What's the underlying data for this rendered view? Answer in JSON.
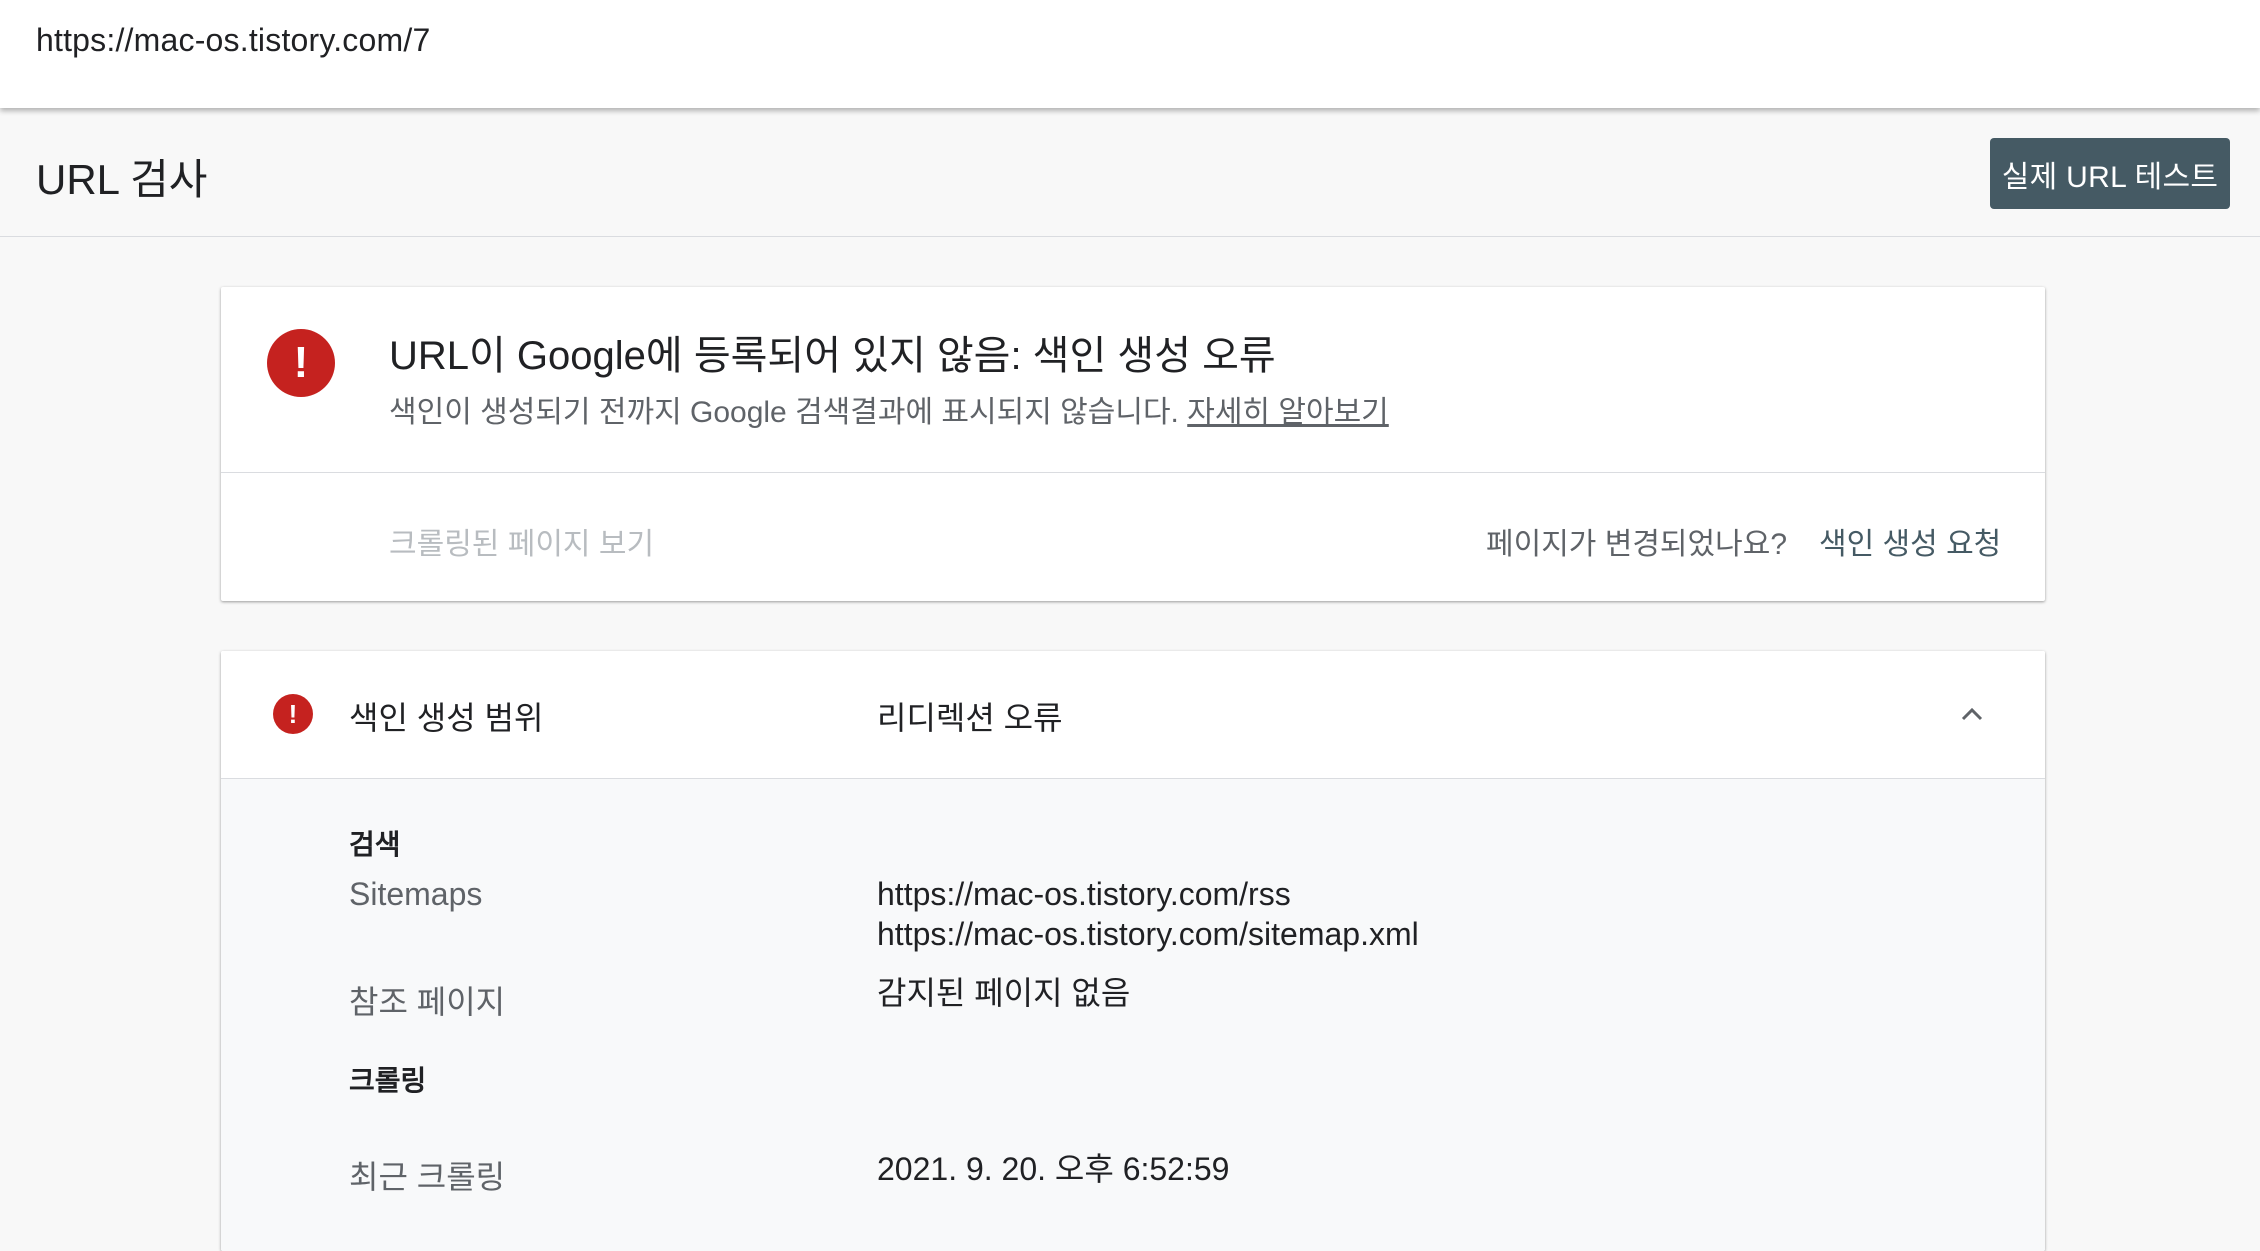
{
  "address_bar": {
    "url": "https://mac-os.tistory.com/7"
  },
  "header": {
    "title": "URL 검사",
    "live_test_label": "실제 URL 테스트"
  },
  "status_card": {
    "headline": "URL이 Google에 등록되어 있지 않음: 색인 생성 오류",
    "subtitle": "색인이 생성되기 전까지 Google 검색결과에 표시되지 않습니다.",
    "learn_more": "자세히 알아보기",
    "view_crawled": "크롤링된 페이지 보기",
    "changed_question": "페이지가 변경되었나요?",
    "request_indexing": "색인 생성 요청",
    "icon": "error-icon"
  },
  "coverage_card": {
    "label": "색인 생성 범위",
    "value": "리디렉션 오류",
    "icon": "error-icon",
    "toggle_icon": "chevron-up-icon",
    "discovery": {
      "heading": "검색",
      "sitemaps_key": "Sitemaps",
      "sitemaps": [
        "https://mac-os.tistory.com/rss",
        "https://mac-os.tistory.com/sitemap.xml"
      ],
      "referring_key": "참조 페이지",
      "referring_value": "감지된 페이지 없음"
    },
    "crawl": {
      "heading": "크롤링",
      "last_crawl_key": "최근 크롤링",
      "last_crawl_value": "2021. 9. 20. 오후 6:52:59"
    }
  },
  "colors": {
    "error": "#c5221f",
    "button_bg": "#455a64",
    "link": "#455a64"
  }
}
